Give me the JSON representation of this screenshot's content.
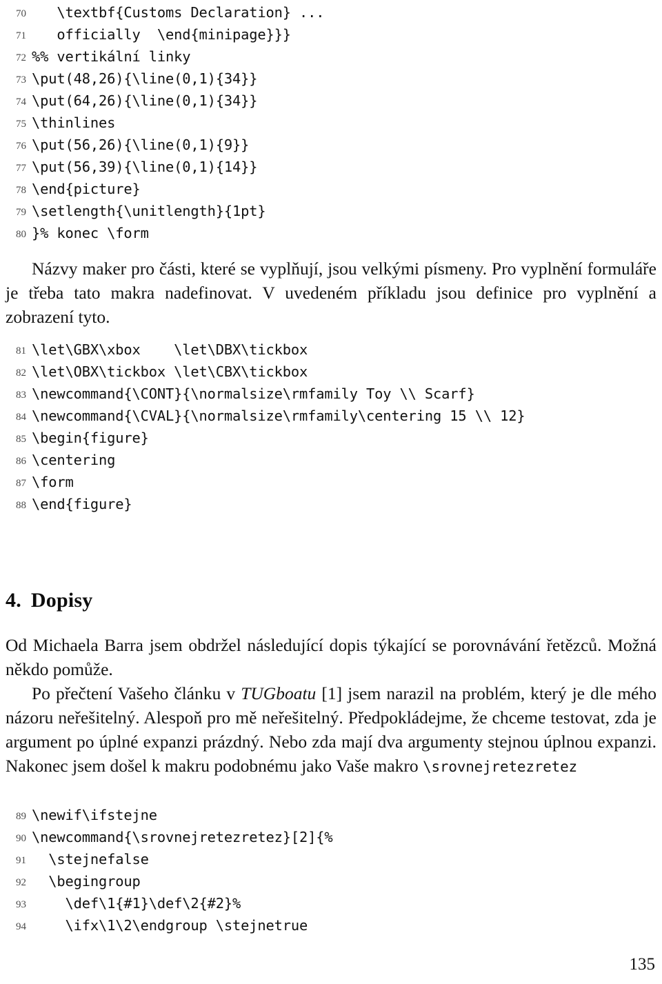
{
  "document": {
    "language": "cs",
    "folio": "135"
  },
  "listing_top": {
    "lines": [
      {
        "number": "70",
        "text": "   \\textbf{Customs Declaration} ..."
      },
      {
        "number": "71",
        "text": "   officially  \\end{minipage}}}"
      },
      {
        "number": "72",
        "text": "%% vertikální linky"
      },
      {
        "number": "73",
        "text": "\\put(48,26){\\line(0,1){34}}"
      },
      {
        "number": "74",
        "text": "\\put(64,26){\\line(0,1){34}}"
      },
      {
        "number": "75",
        "text": "\\thinlines"
      },
      {
        "number": "76",
        "text": "\\put(56,26){\\line(0,1){9}}"
      },
      {
        "number": "77",
        "text": "\\put(56,39){\\line(0,1){14}}"
      },
      {
        "number": "78",
        "text": "\\end{picture}"
      },
      {
        "number": "79",
        "text": "\\setlength{\\unitlength}{1pt}"
      },
      {
        "number": "80",
        "text": "}% konec \\form"
      }
    ]
  },
  "paragraph_1": {
    "text": "Názvy maker pro části, které se vyplňují, jsou velkými písmeny. Pro vyplnění formuláře je třeba tato makra nadefinovat. V uvedeném příkladu jsou definice pro vyplnění a zobrazení tyto."
  },
  "listing_middle": {
    "lines": [
      {
        "number": "81",
        "text": "\\let\\GBX\\xbox    \\let\\DBX\\tickbox"
      },
      {
        "number": "82",
        "text": "\\let\\OBX\\tickbox \\let\\CBX\\tickbox"
      },
      {
        "number": "83",
        "text": "\\newcommand{\\CONT}{\\normalsize\\rmfamily Toy \\\\ Scarf}"
      },
      {
        "number": "84",
        "text": "\\newcommand{\\CVAL}{\\normalsize\\rmfamily\\centering 15 \\\\ 12}"
      },
      {
        "number": "85",
        "text": "\\begin{figure}"
      },
      {
        "number": "86",
        "text": "\\centering"
      },
      {
        "number": "87",
        "text": "\\form"
      },
      {
        "number": "88",
        "text": "\\end{figure}"
      }
    ]
  },
  "section": {
    "number": "4.",
    "title": "Dopisy"
  },
  "paragraph_2": {
    "text": "Od Michaela Barra jsem obdržel následující dopis týkající se porovnávání řetězců. Možná někdo pomůže."
  },
  "paragraph_3": {
    "before_italic": "Po přečtení Vašeho článku v ",
    "italic": "TUGboatu",
    "after_italic": " [1] jsem narazil na problém, který je dle mého názoru neřešitelný. Alespoň pro mě neřešitelný. Předpokládejme, že chceme testovat, zda je argument po úplné expanzi prázdný. Nebo zda mají dva argumenty stejnou úplnou expanzi. Nakonec jsem došel k makru podobnému jako Vaše makro ",
    "mono_tail": "\\srovnejretezretez"
  },
  "listing_bottom": {
    "lines": [
      {
        "number": "89",
        "text": "\\newif\\ifstejne"
      },
      {
        "number": "90",
        "text": "\\newcommand{\\srovnejretezretez}[2]{%"
      },
      {
        "number": "91",
        "text": "  \\stejnefalse"
      },
      {
        "number": "92",
        "text": "  \\begingroup"
      },
      {
        "number": "93",
        "text": "    \\def\\1{#1}\\def\\2{#2}%"
      },
      {
        "number": "94",
        "text": "    \\ifx\\1\\2\\endgroup \\stejnetrue"
      }
    ]
  }
}
